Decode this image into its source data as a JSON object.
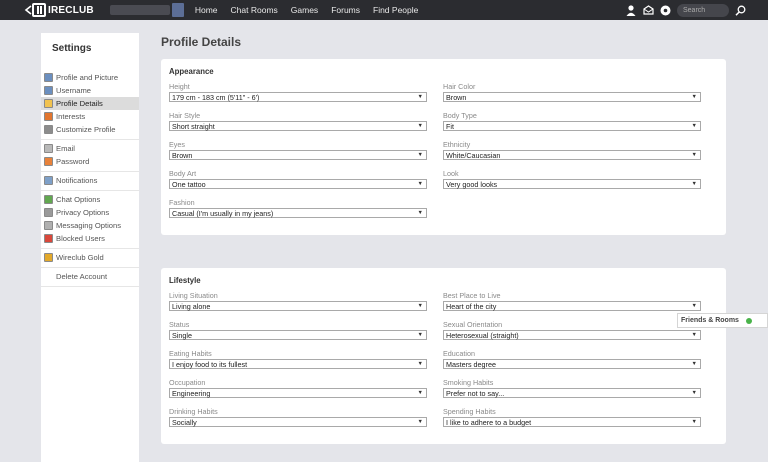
{
  "colors": {
    "topbar": "#2b2c30",
    "page_bg": "#e4e5ea",
    "panel_bg": "#ffffff",
    "active_item": "#dcdcdc",
    "online": "#49b34a"
  },
  "header": {
    "logo_text": "IRECLUB",
    "nav": [
      "Home",
      "Chat Rooms",
      "Games",
      "Forums",
      "Find People"
    ],
    "icons": [
      "user-icon",
      "inbox-icon",
      "settings-icon"
    ],
    "search_placeholder": "Search"
  },
  "sidebar": {
    "title": "Settings",
    "groups": [
      [
        {
          "label": "Profile and Picture",
          "icon": "picture-icon",
          "icon_color": "#6b8fbf",
          "active": false
        },
        {
          "label": "Username",
          "icon": "id-icon",
          "icon_color": "#6b8fbf",
          "active": false
        },
        {
          "label": "Profile Details",
          "icon": "details-icon",
          "icon_color": "#f1c24e",
          "active": true
        },
        {
          "label": "Interests",
          "icon": "interests-icon",
          "icon_color": "#e2762f",
          "active": false
        },
        {
          "label": "Customize Profile",
          "icon": "customize-icon",
          "icon_color": "#8c8c8c",
          "active": false
        }
      ],
      [
        {
          "label": "Email",
          "icon": "email-icon",
          "icon_color": "#b9b9b9",
          "active": false
        },
        {
          "label": "Password",
          "icon": "lock-icon",
          "icon_color": "#e8823a",
          "active": false
        }
      ],
      [
        {
          "label": "Notifications",
          "icon": "notifications-icon",
          "icon_color": "#7ea0c8",
          "active": false
        }
      ],
      [
        {
          "label": "Chat Options",
          "icon": "chat-icon",
          "icon_color": "#62a850",
          "active": false
        },
        {
          "label": "Privacy Options",
          "icon": "privacy-icon",
          "icon_color": "#9a9a9a",
          "active": false
        },
        {
          "label": "Messaging Options",
          "icon": "messaging-icon",
          "icon_color": "#b0b0b0",
          "active": false
        },
        {
          "label": "Blocked Users",
          "icon": "blocked-icon",
          "icon_color": "#d9483b",
          "active": false
        }
      ],
      [
        {
          "label": "Wireclub Gold",
          "icon": "gold-icon",
          "icon_color": "#e3a92b",
          "active": false
        }
      ],
      [
        {
          "label": "Delete Account",
          "icon": "",
          "icon_color": "",
          "active": false
        }
      ]
    ]
  },
  "main": {
    "title": "Profile Details",
    "appearance": {
      "title": "Appearance",
      "fields": [
        {
          "label": "Height",
          "value": "179 cm - 183 cm (5'11\" - 6')"
        },
        {
          "label": "Hair Color",
          "value": "Brown"
        },
        {
          "label": "Hair Style",
          "value": "Short straight"
        },
        {
          "label": "Body Type",
          "value": "Fit"
        },
        {
          "label": "Eyes",
          "value": "Brown"
        },
        {
          "label": "Ethnicity",
          "value": "White/Caucasian"
        },
        {
          "label": "Body Art",
          "value": "One tattoo"
        },
        {
          "label": "Look",
          "value": "Very good looks"
        },
        {
          "label": "Fashion",
          "value": "Casual (I'm usually in my jeans)"
        }
      ]
    },
    "lifestyle": {
      "title": "Lifestyle",
      "fields": [
        {
          "label": "Living Situation",
          "value": "Living alone"
        },
        {
          "label": "Best Place to Live",
          "value": "Heart of the city"
        },
        {
          "label": "Status",
          "value": "Single"
        },
        {
          "label": "Sexual Orientation",
          "value": "Heterosexual (straight)"
        },
        {
          "label": "Eating Habits",
          "value": "I enjoy food to its fullest"
        },
        {
          "label": "Education",
          "value": "Masters degree"
        },
        {
          "label": "Occupation",
          "value": "Engineering"
        },
        {
          "label": "Smoking Habits",
          "value": "Prefer not to say..."
        },
        {
          "label": "Drinking Habits",
          "value": "Socially"
        },
        {
          "label": "Spending Habits",
          "value": "I like to adhere to a budget"
        }
      ]
    }
  },
  "friends_rooms": {
    "label": "Friends & Rooms"
  }
}
